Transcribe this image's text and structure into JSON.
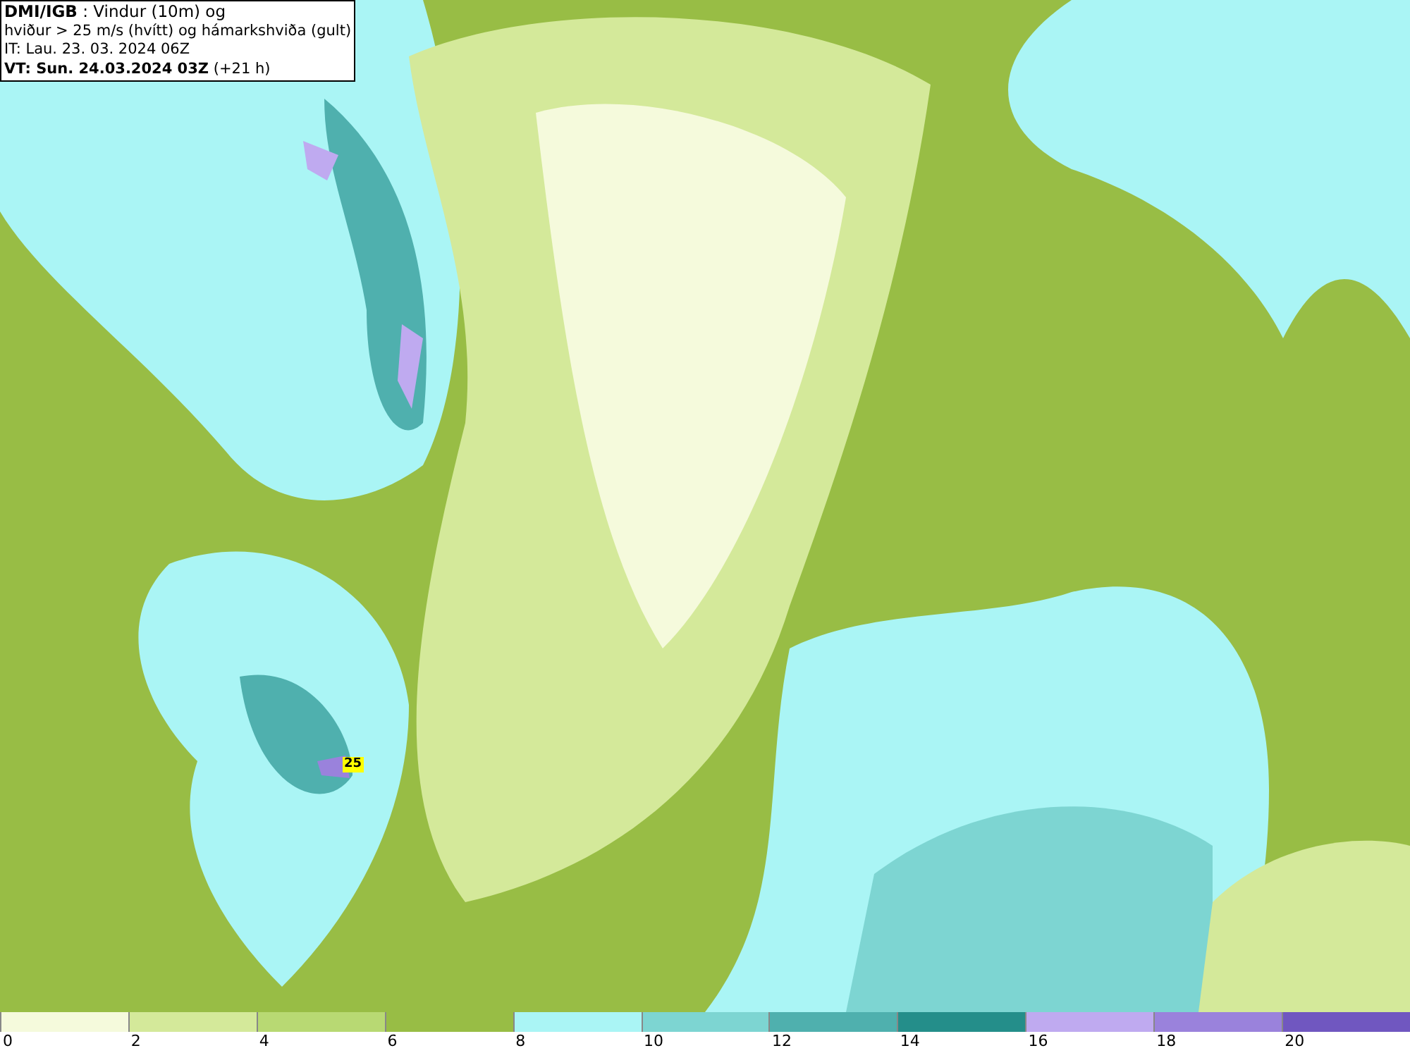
{
  "header": {
    "lines": [
      "**DMI/IGB** : Vindur (10m) og",
      "hviður > 25 m/s (hvítt) og hámarkshviða (gult)",
      "IT: Lau. 23. 03. 2024 06Z",
      "**VT: Sun. 24.03.2024 03Z** (+21 h)"
    ]
  },
  "gust_label": "25",
  "legend": {
    "items": [
      {
        "label": "0",
        "color": "#f5fadc"
      },
      {
        "label": "2",
        "color": "#d4e99a"
      },
      {
        "label": "4",
        "color": "#b8d973"
      },
      {
        "label": "6",
        "color": "#98bd45"
      },
      {
        "label": "8",
        "color": "#aaf5f5"
      },
      {
        "label": "10",
        "color": "#7dd5d2"
      },
      {
        "label": "12",
        "color": "#4fb0ae"
      },
      {
        "label": "14",
        "color": "#248e8a"
      },
      {
        "label": "16",
        "color": "#bfaaf0"
      },
      {
        "label": "18",
        "color": "#9a82dc"
      },
      {
        "label": "20",
        "color": "#7057c0"
      }
    ]
  }
}
